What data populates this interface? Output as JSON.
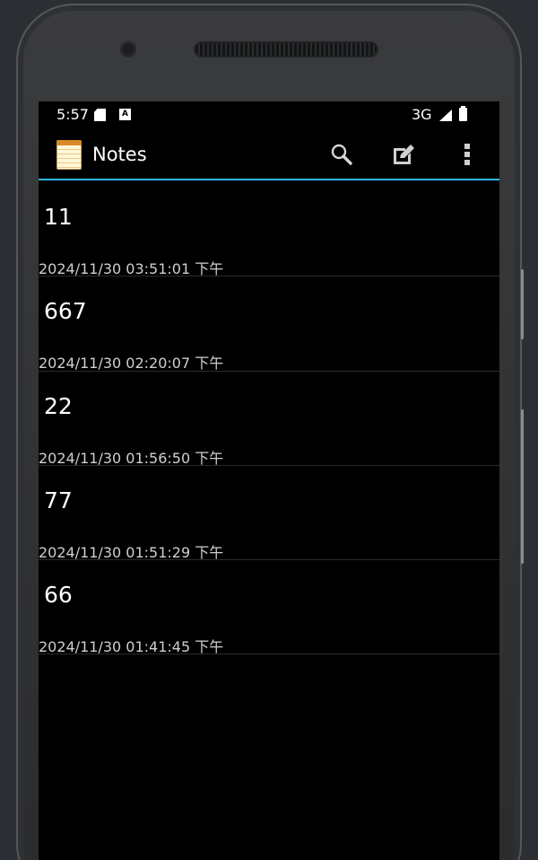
{
  "status_bar": {
    "time": "5:57",
    "network": "3G",
    "icons": [
      "sd-card-icon",
      "a-notification-icon",
      "signal-icon",
      "battery-icon"
    ]
  },
  "action_bar": {
    "title": "Notes",
    "app_icon": "notepad-icon",
    "actions": [
      "search-icon",
      "edit-note-icon",
      "overflow-menu-icon"
    ],
    "accent_color": "#33b5e5"
  },
  "notes": [
    {
      "title": "11",
      "date": "2024/11/30 03:51:01 下午"
    },
    {
      "title": "667",
      "date": "2024/11/30 02:20:07 下午"
    },
    {
      "title": "22",
      "date": "2024/11/30 01:56:50 下午"
    },
    {
      "title": "77",
      "date": "2024/11/30 01:51:29 下午"
    },
    {
      "title": "66",
      "date": "2024/11/30 01:41:45 下午"
    }
  ]
}
